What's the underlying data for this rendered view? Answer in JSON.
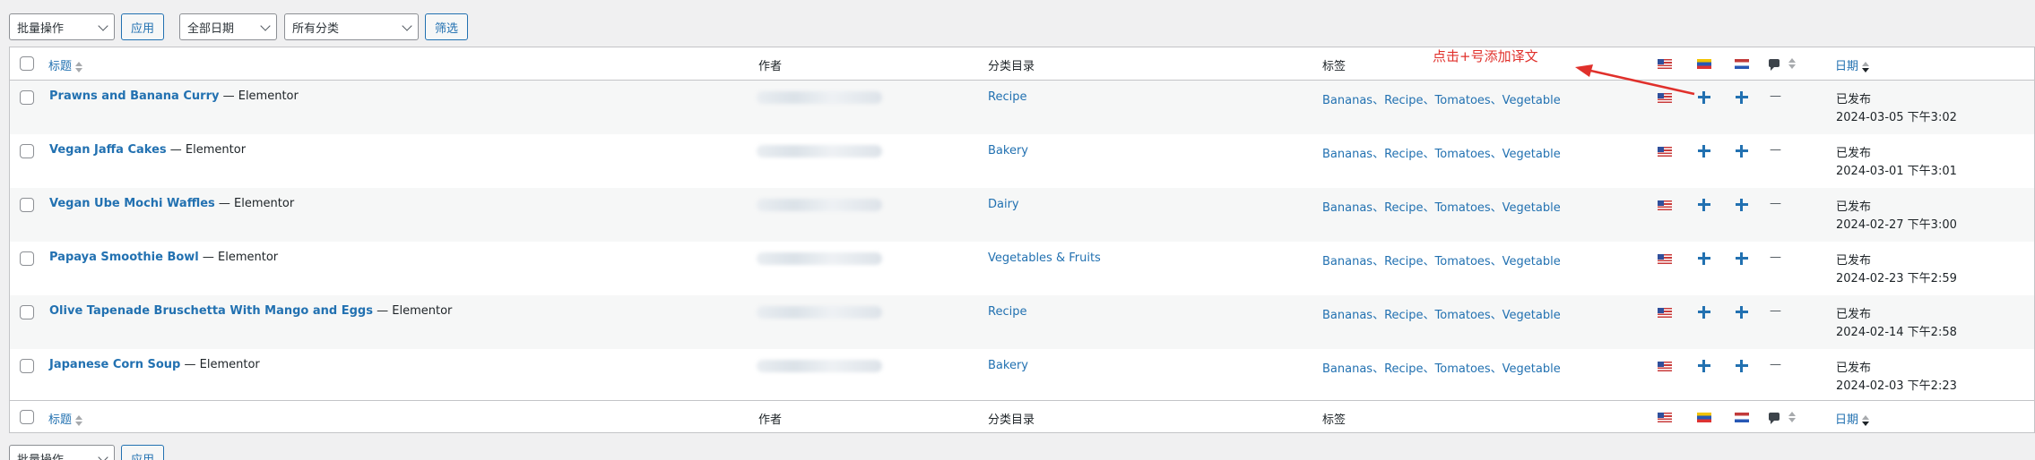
{
  "toolbar_top": {
    "bulk_action": "批量操作",
    "apply": "应用",
    "date_filter": "全部日期",
    "category_filter": "所有分类",
    "filter": "筛选"
  },
  "toolbar_bottom": {
    "bulk_action": "批量操作",
    "apply": "应用"
  },
  "columns": {
    "title": "标题",
    "author": "作者",
    "categories": "分类目录",
    "tags": "标签",
    "date": "日期"
  },
  "annotation": "点击+号添加译文",
  "rows": [
    {
      "title": "Prawns and Banana Curry",
      "suffix": "— Elementor",
      "category": "Recipe",
      "tags": "Bananas、Recipe、Tomatoes、Vegetable",
      "comments": "—",
      "status": "已发布",
      "date": "2024-03-05 下午3:02"
    },
    {
      "title": "Vegan Jaffa Cakes",
      "suffix": "— Elementor",
      "category": "Bakery",
      "tags": "Bananas、Recipe、Tomatoes、Vegetable",
      "comments": "—",
      "status": "已发布",
      "date": "2024-03-01 下午3:01"
    },
    {
      "title": "Vegan Ube Mochi Waffles",
      "suffix": "— Elementor",
      "category": "Dairy",
      "tags": "Bananas、Recipe、Tomatoes、Vegetable",
      "comments": "—",
      "status": "已发布",
      "date": "2024-02-27 下午3:00"
    },
    {
      "title": "Papaya Smoothie Bowl",
      "suffix": "— Elementor",
      "category": "Vegetables & Fruits",
      "tags": "Bananas、Recipe、Tomatoes、Vegetable",
      "comments": "—",
      "status": "已发布",
      "date": "2024-02-23 下午2:59"
    },
    {
      "title": "Olive Tapenade Bruschetta With Mango and Eggs",
      "suffix": "— Elementor",
      "category": "Recipe",
      "tags": "Bananas、Recipe、Tomatoes、Vegetable",
      "comments": "—",
      "status": "已发布",
      "date": "2024-02-14 下午2:58"
    },
    {
      "title": "Japanese Corn Soup",
      "suffix": "— Elementor",
      "category": "Bakery",
      "tags": "Bananas、Recipe、Tomatoes、Vegetable",
      "comments": "—",
      "status": "已发布",
      "date": "2024-02-03 下午2:23"
    }
  ],
  "colors": {
    "accent": "#2271b1",
    "annotation": "#e0302b"
  },
  "icons": [
    "us-flag-icon",
    "venezuela-flag-icon",
    "netherlands-flag-icon",
    "comment-bubble-icon",
    "plus-icon",
    "sort-icon"
  ]
}
